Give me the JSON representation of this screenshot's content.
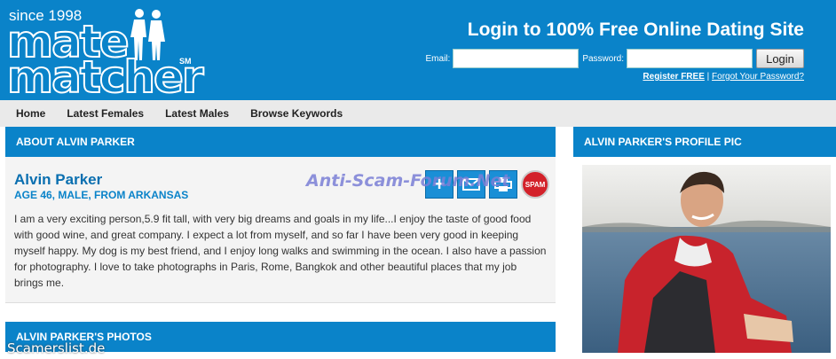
{
  "logo": {
    "since": "since 1998",
    "line1": "mate",
    "line2": "matcher",
    "sm": "SM"
  },
  "login": {
    "title": "Login to 100% Free Online Dating Site",
    "email_label": "Email:",
    "email_value": "",
    "password_label": "Password:",
    "password_value": "",
    "button_label": "Login",
    "register_link": "Register FREE",
    "separator": "|",
    "forgot_link": "Forgot Your Password?"
  },
  "nav": {
    "items": [
      {
        "label": "Home"
      },
      {
        "label": "Latest Females"
      },
      {
        "label": "Latest Males"
      },
      {
        "label": "Browse Keywords"
      }
    ]
  },
  "about": {
    "header": "ABOUT ALVIN PARKER",
    "name": "Alvin Parker",
    "subline": "AGE 46, MALE, FROM ARKANSAS",
    "bio": "I am a very exciting person,5.9 fit tall, with very big dreams and goals in my life...I enjoy the taste of good food with good wine, and great company. I expect a lot from myself, and so far I have been very good in keeping myself happy. My dog is my best friend, and I enjoy long walks and swimming in the ocean. I also have a passion for photography. I love to take photographs in Paris, Rome, Bangkok and other beautiful places that my job brings me."
  },
  "actions": {
    "add_icon": "plus-icon",
    "mail_icon": "envelope-icon",
    "print_icon": "printer-icon",
    "spam_label": "SPAM"
  },
  "profile_pic": {
    "header": "ALVIN PARKER'S PROFILE PIC"
  },
  "photos": {
    "header": "ALVIN PARKER'S PHOTOS"
  },
  "watermarks": {
    "center": "Anti-Scam-Forum.Net",
    "bottom": "Scamerslist.de"
  },
  "colors": {
    "brand_blue": "#0a83c9",
    "nav_bg": "#eaeaea",
    "spam_red": "#d3212a"
  }
}
